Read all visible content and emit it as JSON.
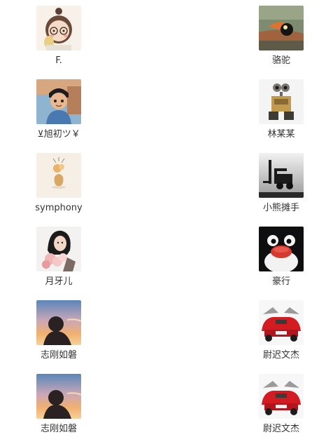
{
  "contacts_left": [
    {
      "name": "F.",
      "avatar_icon": "cartoon-girl-avatar-icon"
    },
    {
      "name": "⊻旭初ツ￥",
      "avatar_icon": "cartoon-boy-avatar-icon"
    },
    {
      "name": "symphony",
      "avatar_icon": "flower-vase-avatar-icon"
    },
    {
      "name": "月牙儿",
      "avatar_icon": "girl-with-flowers-avatar-icon"
    },
    {
      "name": "志刚如磐",
      "avatar_icon": "sunset-silhouette-avatar-icon"
    },
    {
      "name": "志刚如磐",
      "avatar_icon": "sunset-silhouette-avatar-icon"
    }
  ],
  "contacts_right": [
    {
      "name": "骆驼",
      "avatar_icon": "toucan-avatar-icon"
    },
    {
      "name": "林某某",
      "avatar_icon": "robot-avatar-icon"
    },
    {
      "name": "小熊摊手",
      "avatar_icon": "forklift-avatar-icon"
    },
    {
      "name": "豪行",
      "avatar_icon": "penguin-avatar-icon"
    },
    {
      "name": "尉迟文杰",
      "avatar_icon": "red-sports-car-avatar-icon"
    },
    {
      "name": "尉迟文杰",
      "avatar_icon": "red-sports-car-avatar-icon"
    }
  ],
  "colors": {
    "name_text": "#333333",
    "background": "#ffffff"
  }
}
